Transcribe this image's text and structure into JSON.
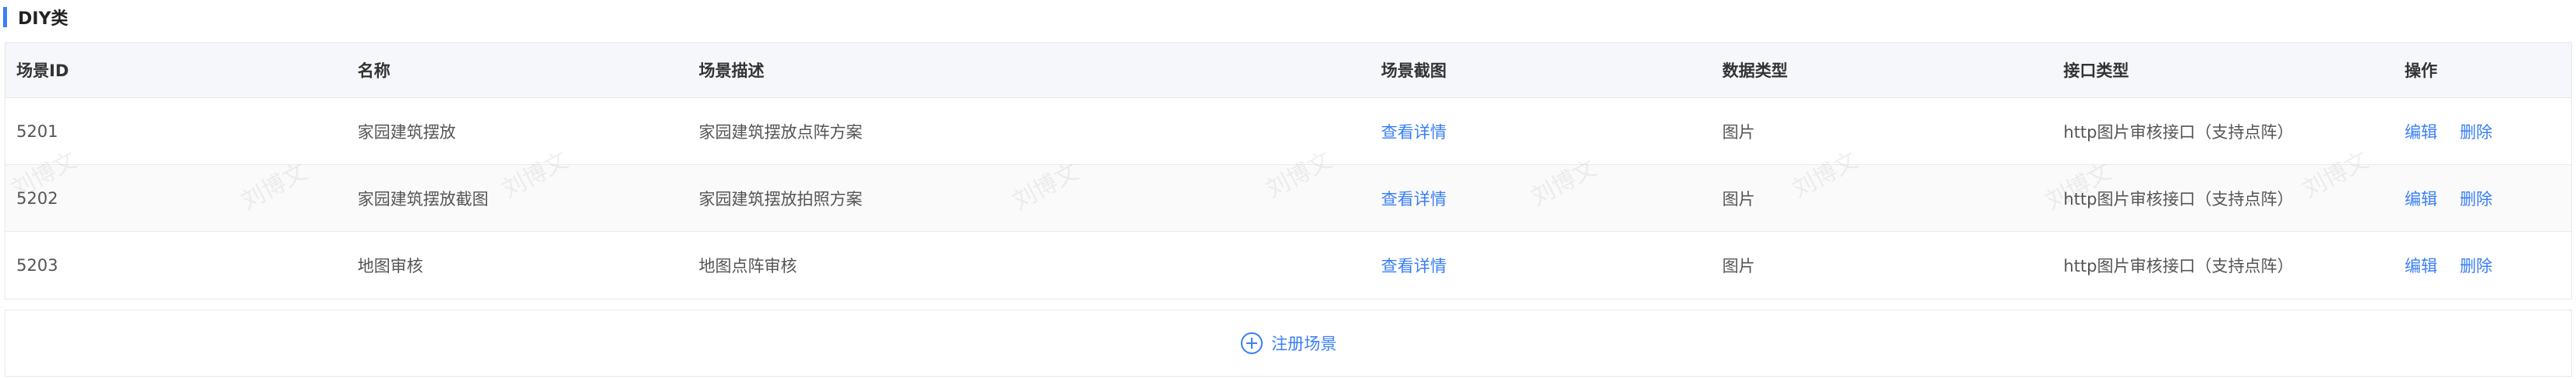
{
  "section": {
    "title": "DIY类"
  },
  "table": {
    "headers": [
      "场景ID",
      "名称",
      "场景描述",
      "场景截图",
      "数据类型",
      "接口类型",
      "操作"
    ],
    "rows": [
      {
        "id": "5201",
        "name": "家园建筑摆放",
        "desc": "家园建筑摆放点阵方案",
        "screenshot": "查看详情",
        "data_type": "图片",
        "api_type": "http图片审核接口（支持点阵）",
        "edit": "编辑",
        "delete": "删除"
      },
      {
        "id": "5202",
        "name": "家园建筑摆放截图",
        "desc": "家园建筑摆放拍照方案",
        "screenshot": "查看详情",
        "data_type": "图片",
        "api_type": "http图片审核接口（支持点阵）",
        "edit": "编辑",
        "delete": "删除"
      },
      {
        "id": "5203",
        "name": "地图审核",
        "desc": "地图点阵审核",
        "screenshot": "查看详情",
        "data_type": "图片",
        "api_type": "http图片审核接口（支持点阵）",
        "edit": "编辑",
        "delete": "删除"
      }
    ]
  },
  "register": {
    "label": "注册场景",
    "icon": "plus-circle-icon"
  },
  "watermark": {
    "text": "刘博文"
  },
  "colors": {
    "accent": "#3a7ff6",
    "header_bg": "#f5f7fa",
    "border": "#e6e8ec"
  }
}
